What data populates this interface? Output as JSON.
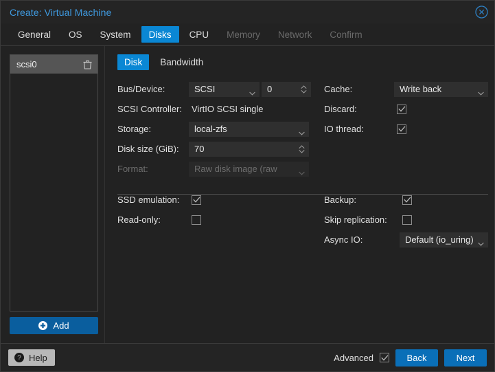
{
  "window": {
    "title": "Create: Virtual Machine",
    "close_icon": "close-circle-icon",
    "title_color": "#3f9ae0"
  },
  "tabs": [
    {
      "label": "General",
      "active": false,
      "disabled": false
    },
    {
      "label": "OS",
      "active": false,
      "disabled": false
    },
    {
      "label": "System",
      "active": false,
      "disabled": false
    },
    {
      "label": "Disks",
      "active": true,
      "disabled": false
    },
    {
      "label": "CPU",
      "active": false,
      "disabled": false
    },
    {
      "label": "Memory",
      "active": false,
      "disabled": true
    },
    {
      "label": "Network",
      "active": false,
      "disabled": true
    },
    {
      "label": "Confirm",
      "active": false,
      "disabled": true
    }
  ],
  "disk_list": {
    "items": [
      {
        "label": "scsi0",
        "selected": true,
        "delete_icon": "trash-icon"
      }
    ],
    "add_label": "Add",
    "add_icon": "plus-circle-icon"
  },
  "subtabs": [
    {
      "label": "Disk",
      "active": true
    },
    {
      "label": "Bandwidth",
      "active": false
    }
  ],
  "form": {
    "bus_device": {
      "label": "Bus/Device:",
      "bus_value": "SCSI",
      "device_value": "0"
    },
    "scsi_controller": {
      "label": "SCSI Controller:",
      "value": "VirtIO SCSI single"
    },
    "storage": {
      "label": "Storage:",
      "value": "local-zfs"
    },
    "disk_size": {
      "label": "Disk size (GiB):",
      "value": "70"
    },
    "format": {
      "label": "Format:",
      "value": "Raw disk image (raw",
      "disabled": true
    },
    "cache": {
      "label": "Cache:",
      "value": "Write back"
    },
    "discard": {
      "label": "Discard:",
      "checked": true
    },
    "io_thread": {
      "label": "IO thread:",
      "checked": true
    }
  },
  "advanced_form": {
    "ssd_emulation": {
      "label": "SSD emulation:",
      "checked": true
    },
    "read_only": {
      "label": "Read-only:",
      "checked": false
    },
    "backup": {
      "label": "Backup:",
      "checked": true
    },
    "skip_replication": {
      "label": "Skip replication:",
      "checked": false
    },
    "async_io": {
      "label": "Async IO:",
      "value": "Default (io_uring)"
    }
  },
  "footer": {
    "help_label": "Help",
    "help_icon": "question-circle-icon",
    "advanced_label": "Advanced",
    "advanced_checked": true,
    "back_label": "Back",
    "next_label": "Next"
  },
  "colors": {
    "accent": "#0a87d4",
    "button_blue": "#0a6fb8",
    "add_blue": "#0a5e9e",
    "window_bg": "#222222",
    "title_blue": "#3f9ae0"
  }
}
